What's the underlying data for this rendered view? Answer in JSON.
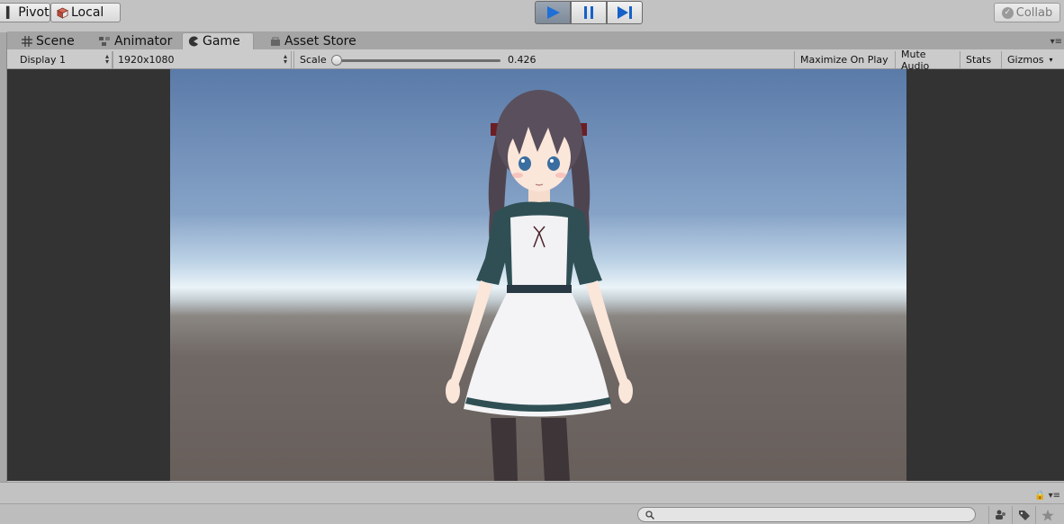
{
  "toolbar": {
    "pivot_label": "Pivot",
    "local_label": "Local",
    "collab_label": "Collab"
  },
  "tabs": [
    {
      "label": "Scene",
      "icon": "grid-icon"
    },
    {
      "label": "Animator",
      "icon": "animator-icon"
    },
    {
      "label": "Game",
      "icon": "pacman-icon",
      "active": true
    },
    {
      "label": "Asset Store",
      "icon": "store-icon"
    }
  ],
  "game_toolbar": {
    "display": "Display 1",
    "resolution": "1920x1080",
    "scale_label": "Scale",
    "scale_value": "0.426",
    "maximize_label": "Maximize On Play",
    "mute_label": "Mute Audio",
    "stats_label": "Stats",
    "gizmos_label": "Gizmos"
  },
  "search": {
    "placeholder": ""
  },
  "colors": {
    "play_active": "#1f6fd6",
    "accent_blue": "#1561c7"
  }
}
